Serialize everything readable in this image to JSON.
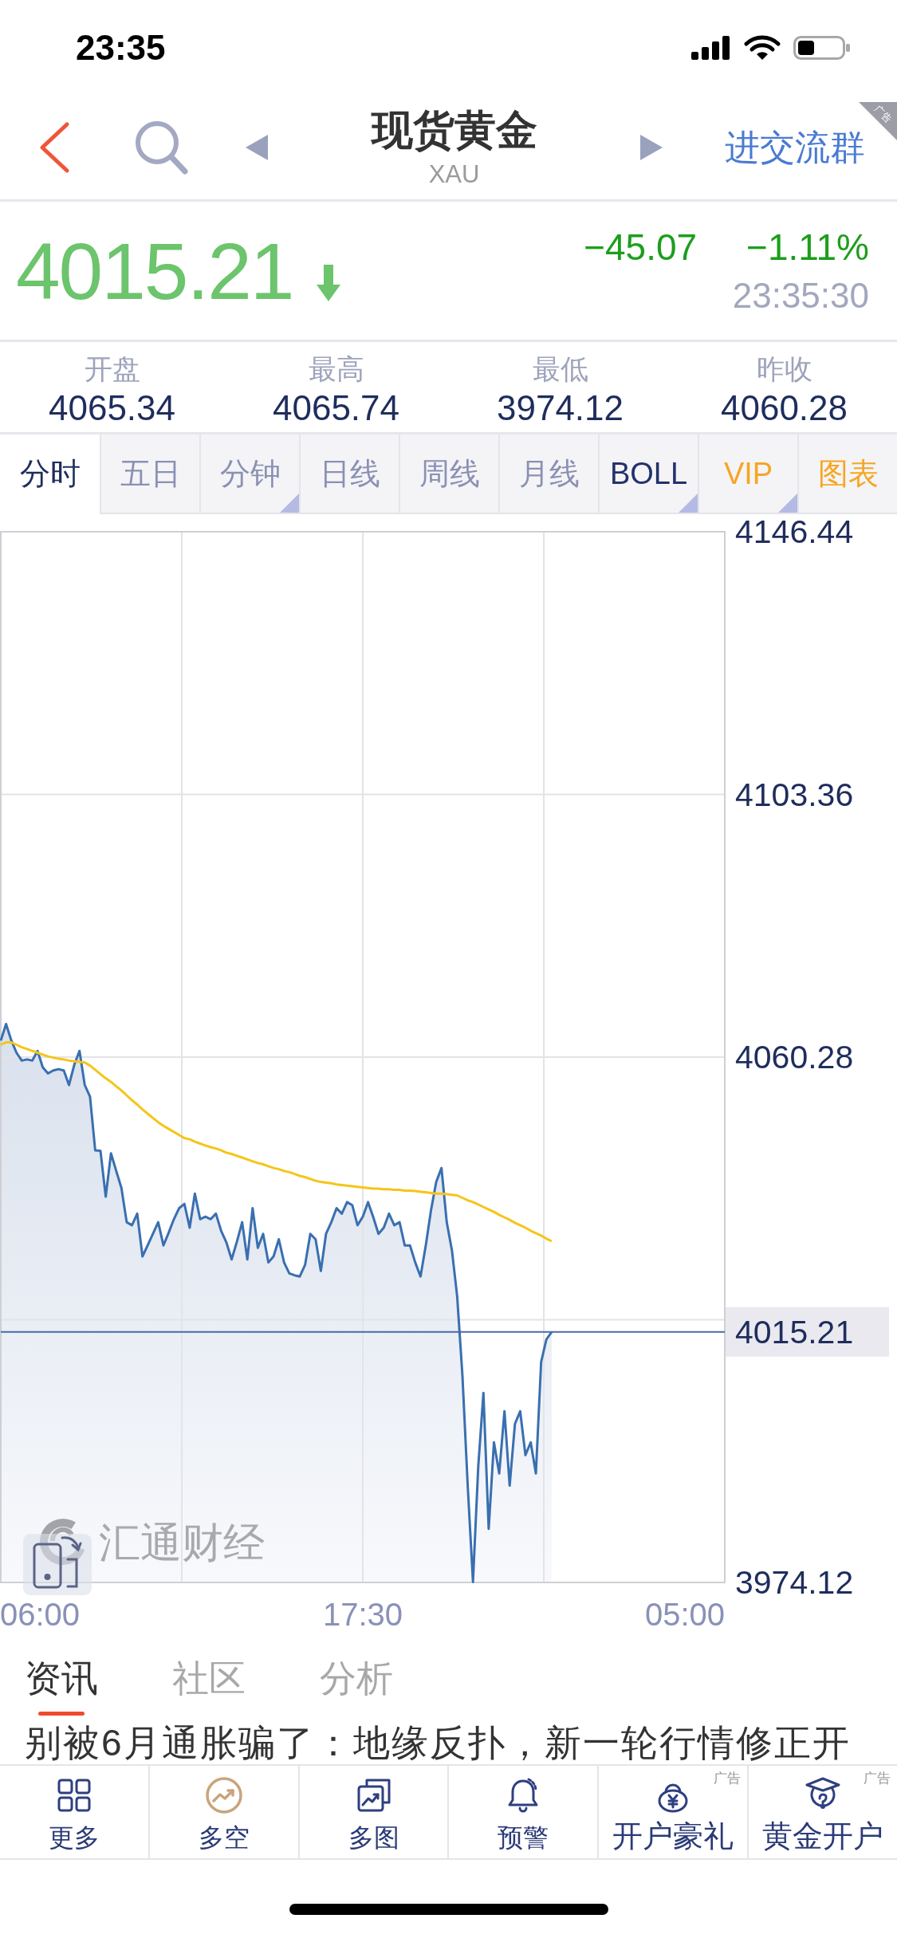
{
  "status_bar": {
    "time": "23:35"
  },
  "nav": {
    "title": "现货黄金",
    "subtitle": "XAU",
    "action": "进交流群",
    "ad_tag": "广告"
  },
  "quote": {
    "price": "4015.21",
    "falling": true,
    "change": "−45.07",
    "change_percent": "−1.11%",
    "time": "23:35:30"
  },
  "stats": [
    {
      "label": "开盘",
      "value": "4065.34"
    },
    {
      "label": "最高",
      "value": "4065.74"
    },
    {
      "label": "最低",
      "value": "3974.12"
    },
    {
      "label": "昨收",
      "value": "4060.28"
    }
  ],
  "period_tabs": [
    {
      "label": "分时",
      "kind": "period",
      "selected": true,
      "menu": false
    },
    {
      "label": "五日",
      "kind": "period",
      "selected": false,
      "menu": false
    },
    {
      "label": "分钟",
      "kind": "period",
      "selected": false,
      "menu": true
    },
    {
      "label": "日线",
      "kind": "period",
      "selected": false,
      "menu": false
    },
    {
      "label": "周线",
      "kind": "period",
      "selected": false,
      "menu": false
    },
    {
      "label": "月线",
      "kind": "period",
      "selected": false,
      "menu": false
    },
    {
      "label": "BOLL",
      "kind": "indicator",
      "selected": false,
      "menu": true
    },
    {
      "label": "VIP",
      "kind": "promo",
      "selected": false,
      "menu": true
    },
    {
      "label": "图表",
      "kind": "promo",
      "selected": false,
      "menu": false
    }
  ],
  "chart": {
    "brand": "汇通财经",
    "chart_data": {
      "type": "line",
      "categories": [
        null,
        null,
        null,
        null,
        null,
        null,
        null,
        "06:00",
        null,
        null,
        null,
        null,
        null,
        null,
        null,
        null,
        null,
        null,
        null,
        null,
        null,
        null,
        null,
        null,
        null,
        null,
        null,
        null,
        null,
        null,
        null,
        null,
        null,
        null,
        null,
        null,
        null,
        null,
        null,
        null,
        null,
        null,
        null,
        null,
        null,
        null,
        null,
        null,
        null,
        null,
        null,
        null,
        null,
        null,
        null,
        null,
        null,
        null,
        null,
        null,
        null,
        null,
        null,
        null,
        null,
        null,
        null,
        null,
        null,
        "17:30",
        null,
        null,
        null,
        null,
        null,
        null,
        null,
        null,
        null,
        null,
        null,
        null,
        null,
        null,
        null,
        null,
        null,
        null,
        null,
        null,
        null,
        null,
        null,
        null,
        null,
        null,
        null,
        null,
        null,
        null,
        null,
        null,
        null,
        null,
        null,
        null,
        null,
        null,
        null,
        null,
        null,
        null,
        null,
        null,
        null,
        null,
        null,
        null,
        null,
        null,
        null,
        null,
        null,
        null,
        null,
        null,
        null,
        null,
        null,
        null,
        null,
        "05:00",
        null,
        null,
        null,
        null,
        null,
        null,
        null
      ],
      "series": [
        {
          "color": "#3a6fb0",
          "values": [
            4063.0,
            4065.7,
            4063.0,
            4061.0,
            4059.7,
            4059.9,
            4059.7,
            4061.3,
            4058.6,
            4057.6,
            4058.1,
            4058.3,
            4058.1,
            4055.7,
            4059.0,
            4061.3,
            4055.7,
            4053.8,
            4045.0,
            4044.9,
            4037.4,
            4044.5,
            4041.6,
            4038.8,
            4033.2,
            4032.7,
            4034.6,
            4027.6,
            4029.4,
            4031.3,
            4033.2,
            4029.4,
            4031.5,
            4033.7,
            4035.5,
            4036.2,
            4032.3,
            4037.9,
            4033.7,
            4034.1,
            4033.7,
            4034.6,
            4031.8,
            4029.9,
            4027.1,
            4030.0,
            4033.2,
            4027.1,
            4035.5,
            4029.0,
            4031.3,
            4026.6,
            4027.6,
            4030.4,
            4026.6,
            4024.8,
            4024.5,
            4024.3,
            4026.2,
            4031.3,
            4030.4,
            4025.2,
            4031.3,
            4033.2,
            4035.5,
            4034.6,
            4036.5,
            4036.0,
            4032.7,
            4034.1,
            4036.5,
            4034.0,
            4031.3,
            4032.3,
            4034.6,
            4032.7,
            4033.2,
            4029.4,
            4029.4,
            4026.6,
            4024.3,
            4029.4,
            4035.1,
            4039.8,
            4042.1,
            4033.2,
            4028.5,
            4021.0,
            4008.0,
            3990.0,
            3974.2,
            3993.1,
            4005.2,
            3982.9,
            3997.1,
            3992.0,
            4002.2,
            3990.0,
            4000.1,
            4002.2,
            3995.0,
            3997.1,
            3992.0,
            4010.3,
            4014.0,
            4015.2,
            null,
            null,
            null,
            null,
            null,
            null,
            null,
            null,
            null,
            null,
            null,
            null,
            null,
            null,
            null,
            null,
            null,
            null,
            null,
            null,
            null,
            null,
            null,
            null,
            null,
            null,
            null,
            null,
            null,
            null,
            null,
            null,
            null
          ]
        },
        {
          "color": "#f5c518",
          "values": [
            4062.3,
            4062.7,
            4062.7,
            4062.3,
            4061.9,
            4061.6,
            4061.3,
            4061.0,
            4060.7,
            4060.4,
            4060.2,
            4060.0,
            4059.9,
            4059.7,
            4059.6,
            4059.5,
            4059.4,
            4058.9,
            4058.2,
            4057.5,
            4056.8,
            4056.2,
            4055.5,
            4054.8,
            4054.0,
            4053.2,
            4052.5,
            4051.7,
            4051.0,
            4050.3,
            4049.6,
            4049.0,
            4048.5,
            4048.0,
            4047.5,
            4047.0,
            4046.8,
            4046.4,
            4046.1,
            4045.8,
            4045.5,
            4045.3,
            4045.0,
            4044.6,
            4044.4,
            4044.1,
            4043.8,
            4043.5,
            4043.2,
            4042.9,
            4042.7,
            4042.4,
            4042.1,
            4041.9,
            4041.6,
            4041.4,
            4041.1,
            4040.8,
            4040.6,
            4040.3,
            4040.0,
            4039.8,
            4039.7,
            4039.6,
            4039.4,
            4039.3,
            4039.2,
            4039.1,
            4039.0,
            4038.9,
            4038.8,
            4038.7,
            4038.7,
            4038.6,
            4038.6,
            4038.5,
            4038.5,
            4038.4,
            4038.4,
            4038.3,
            4038.2,
            4038.1,
            4038.0,
            4037.9,
            4037.9,
            4037.8,
            4037.7,
            4037.6,
            4037.2,
            4036.8,
            4036.5,
            4036.1,
            4035.7,
            4035.3,
            4034.9,
            4034.4,
            4034.0,
            4033.6,
            4033.1,
            4032.7,
            4032.3,
            4031.8,
            4031.4,
            4031.0,
            4030.5,
            4030.1,
            null,
            null,
            null,
            null,
            null,
            null,
            null,
            null,
            null,
            null,
            null,
            null,
            null,
            null,
            null,
            null,
            null,
            null,
            null,
            null,
            null,
            null,
            null,
            null,
            null,
            null,
            null,
            null,
            null,
            null,
            null,
            null,
            null
          ]
        },
        {
          "name": "4015.21",
          "color": "#4a68a6",
          "values": [
            4015.21,
            4015.21,
            4015.21,
            4015.21,
            4015.21,
            4015.21,
            4015.21,
            4015.21,
            4015.21,
            4015.21,
            4015.21,
            4015.21,
            4015.21,
            4015.21,
            4015.21,
            4015.21,
            4015.21,
            4015.21,
            4015.21,
            4015.21,
            4015.21,
            4015.21,
            4015.21,
            4015.21,
            4015.21,
            4015.21,
            4015.21,
            4015.21,
            4015.21,
            4015.21,
            4015.21,
            4015.21,
            4015.21,
            4015.21,
            4015.21,
            4015.21,
            4015.21,
            4015.21,
            4015.21,
            4015.21,
            4015.21,
            4015.21,
            4015.21,
            4015.21,
            4015.21,
            4015.21,
            4015.21,
            4015.21,
            4015.21,
            4015.21,
            4015.21,
            4015.21,
            4015.21,
            4015.21,
            4015.21,
            4015.21,
            4015.21,
            4015.21,
            4015.21,
            4015.21,
            4015.21,
            4015.21,
            4015.21,
            4015.21,
            4015.21,
            4015.21,
            4015.21,
            4015.21,
            4015.21,
            4015.21,
            4015.21,
            4015.21,
            4015.21,
            4015.21,
            4015.21,
            4015.21,
            4015.21,
            4015.21,
            4015.21,
            4015.21,
            4015.21,
            4015.21,
            4015.21,
            4015.21,
            4015.21,
            4015.21,
            4015.21,
            4015.21,
            4015.21,
            4015.21,
            4015.21,
            4015.21,
            4015.21,
            4015.21,
            4015.21,
            4015.21,
            4015.21,
            4015.21,
            4015.21,
            4015.21,
            4015.21,
            4015.21,
            4015.21,
            4015.21,
            4015.21,
            4015.21,
            4015.21,
            4015.21,
            4015.21,
            4015.21,
            4015.21,
            4015.21,
            4015.21,
            4015.21,
            4015.21,
            4015.21,
            4015.21,
            4015.21,
            4015.21,
            4015.21,
            4015.21,
            4015.21,
            4015.21,
            4015.21,
            4015.21,
            4015.21,
            4015.21,
            4015.21,
            4015.21,
            4015.21,
            4015.21,
            4015.21,
            4015.21,
            4015.21,
            4015.21,
            4015.21,
            4015.21,
            4015.21,
            4015.21
          ]
        }
      ],
      "ylim": [
        3974.12,
        4146.44
      ],
      "yticks": [
        4146.44,
        4103.36,
        4060.28,
        3974.12
      ]
    }
  },
  "news_tabs": [
    {
      "label": "资讯",
      "selected": true
    },
    {
      "label": "社区",
      "selected": false
    },
    {
      "label": "分析",
      "selected": false
    }
  ],
  "news": [
    {
      "title": "别被6月通胀骗了：地缘反扑，新一轮行情修正开"
    }
  ],
  "bottom_nav": [
    {
      "label": "更多"
    },
    {
      "label": "多空"
    },
    {
      "label": "多图"
    },
    {
      "label": "预警"
    },
    {
      "label": "开户豪礼",
      "tag": "广告"
    },
    {
      "label": "黄金开户",
      "tag": "广告"
    }
  ]
}
